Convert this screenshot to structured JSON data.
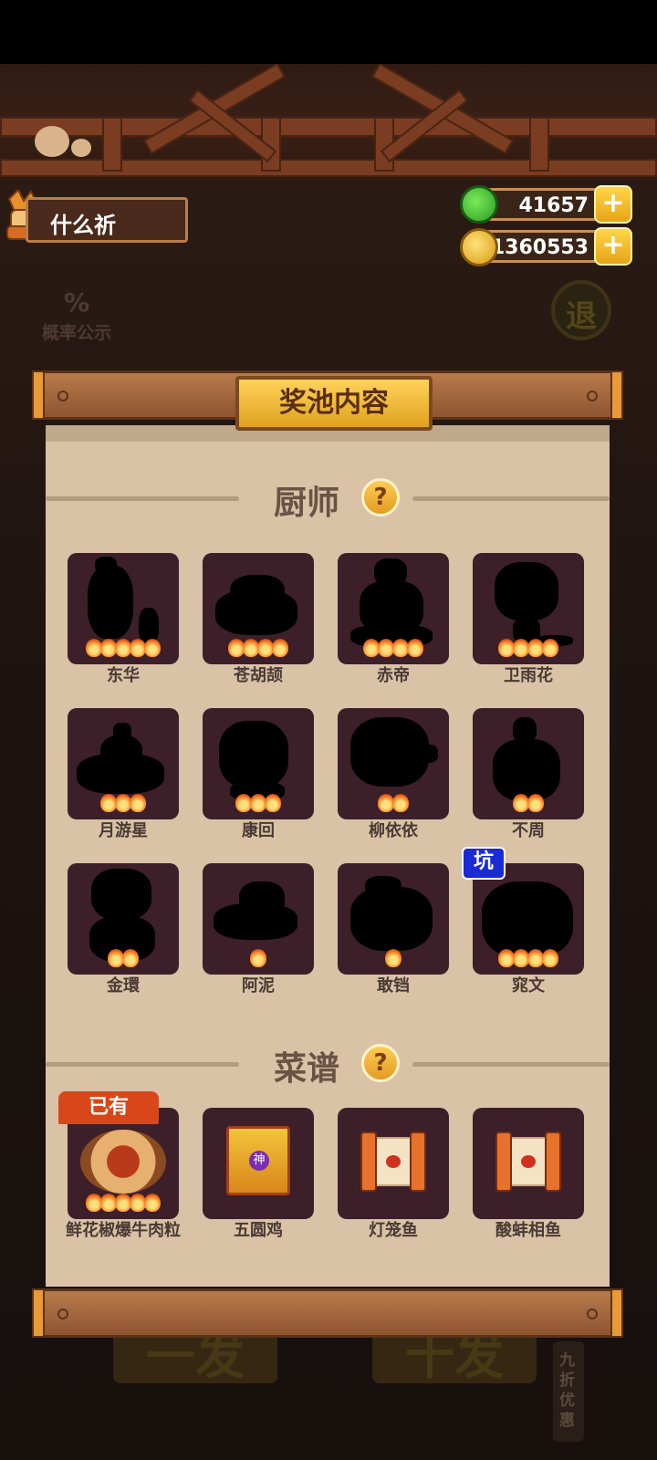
{
  "player": {
    "name": "什么祈"
  },
  "currency": {
    "gems": "41657",
    "coins": "11360553",
    "plus_label": "+"
  },
  "background": {
    "probability_label": "概率公示",
    "probability_icon": "%",
    "exit_label": "退",
    "single_draw": "一发",
    "ten_draw": "十发",
    "discount": "九折优惠"
  },
  "panel": {
    "title": "奖池内容",
    "chef_section": "厨师",
    "recipe_section": "菜谱",
    "help_icon": "?",
    "chefs": [
      {
        "name": "东华",
        "stars": 5
      },
      {
        "name": "苍胡颉",
        "stars": 4
      },
      {
        "name": "赤帝",
        "stars": 4
      },
      {
        "name": "卫雨花",
        "stars": 4
      },
      {
        "name": "月游星",
        "stars": 3
      },
      {
        "name": "康回",
        "stars": 3
      },
      {
        "name": "柳依依",
        "stars": 2
      },
      {
        "name": "不周",
        "stars": 2
      },
      {
        "name": "金環",
        "stars": 2
      },
      {
        "name": "阿泥",
        "stars": 1
      },
      {
        "name": "敢铛",
        "stars": 1
      },
      {
        "name": "窕文",
        "stars": 4,
        "badge": "坑"
      }
    ],
    "recipes": [
      {
        "name": "鲜花椒爆牛肉粒",
        "stars": 5,
        "badge": "已有"
      },
      {
        "name": "五圆鸡",
        "stars": 0,
        "icon_label": "神"
      },
      {
        "name": "灯笼鱼",
        "stars": 0
      },
      {
        "name": "酸蚌相鱼",
        "stars": 0
      }
    ]
  },
  "colors": {
    "card_bg": "#3c1f28",
    "paper": "#d9c2a6",
    "gold": "#e0a21e",
    "badge_blue": "#1a2bd6",
    "badge_red": "#d8471a"
  }
}
